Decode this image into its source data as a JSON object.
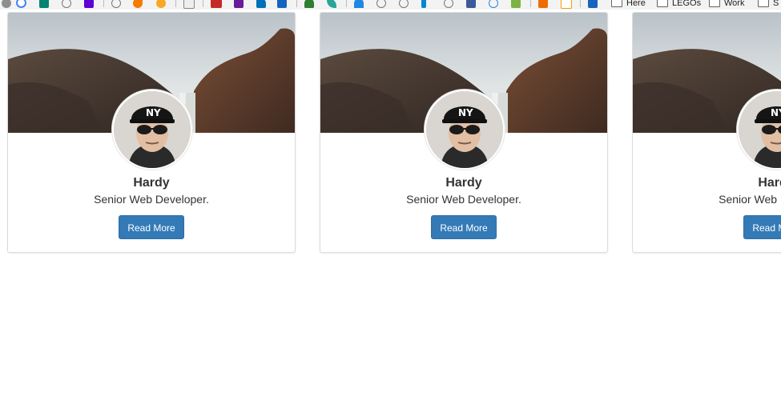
{
  "bookmarks_bar": {
    "folders": [
      {
        "label": "Here"
      },
      {
        "label": "LEGOs"
      },
      {
        "label": "Work"
      },
      {
        "label": "S"
      }
    ],
    "icons": [
      {
        "name": "chrome-apps-icon",
        "color": "#8e8e8e"
      },
      {
        "name": "google-icon",
        "color": "#4285f4"
      },
      {
        "name": "bing-icon",
        "color": "#008373"
      },
      {
        "name": "globe-icon",
        "color": "#9aa0a6"
      },
      {
        "name": "yahoo-icon",
        "color": "#5f01d1"
      },
      {
        "name": "globe-icon",
        "color": "#9aa0a6"
      },
      {
        "name": "orange-bookmark-icon",
        "color": "#f57c00"
      },
      {
        "name": "yellow-bookmark-icon",
        "color": "#f9a825"
      },
      {
        "name": "blank-page-icon",
        "color": "#cfcfcf"
      },
      {
        "name": "red-bookmark-icon",
        "color": "#c62828"
      },
      {
        "name": "purple-bookmark-icon",
        "color": "#6a1b9a"
      },
      {
        "name": "paypal-icon",
        "color": "#0070ba"
      },
      {
        "name": "blue-square-icon",
        "color": "#1565c0"
      },
      {
        "name": "palm-icon",
        "color": "#2e7d32"
      },
      {
        "name": "leaf-icon",
        "color": "#26a69a"
      },
      {
        "name": "wifi-icon",
        "color": "#1e88e5"
      },
      {
        "name": "globe-icon",
        "color": "#9aa0a6"
      },
      {
        "name": "globe-icon",
        "color": "#9aa0a6"
      },
      {
        "name": "check-icon",
        "color": "#0288d1"
      },
      {
        "name": "globe-icon",
        "color": "#9aa0a6"
      },
      {
        "name": "facebook-icon",
        "color": "#3b5998"
      },
      {
        "name": "globe-icon",
        "color": "#1e88e5"
      },
      {
        "name": "green-bookmark-icon",
        "color": "#7cb342"
      },
      {
        "name": "orange-u-icon",
        "color": "#ef6c00"
      },
      {
        "name": "amazon-icon",
        "color": "#ff9900"
      },
      {
        "name": "grid-icon",
        "color": "#1565c0"
      }
    ]
  },
  "cards": [
    {
      "name": "Hardy",
      "title": "Senior Web Developer.",
      "button_label": "Read More"
    },
    {
      "name": "Hardy",
      "title": "Senior Web Developer.",
      "button_label": "Read More"
    },
    {
      "name": "Hardy",
      "title": "Senior Web Developer.",
      "button_label": "Read More"
    }
  ],
  "colors": {
    "button_bg": "#337ab7",
    "button_border": "#2e6da4",
    "text": "#333333",
    "card_border": "#dcdcdc"
  }
}
